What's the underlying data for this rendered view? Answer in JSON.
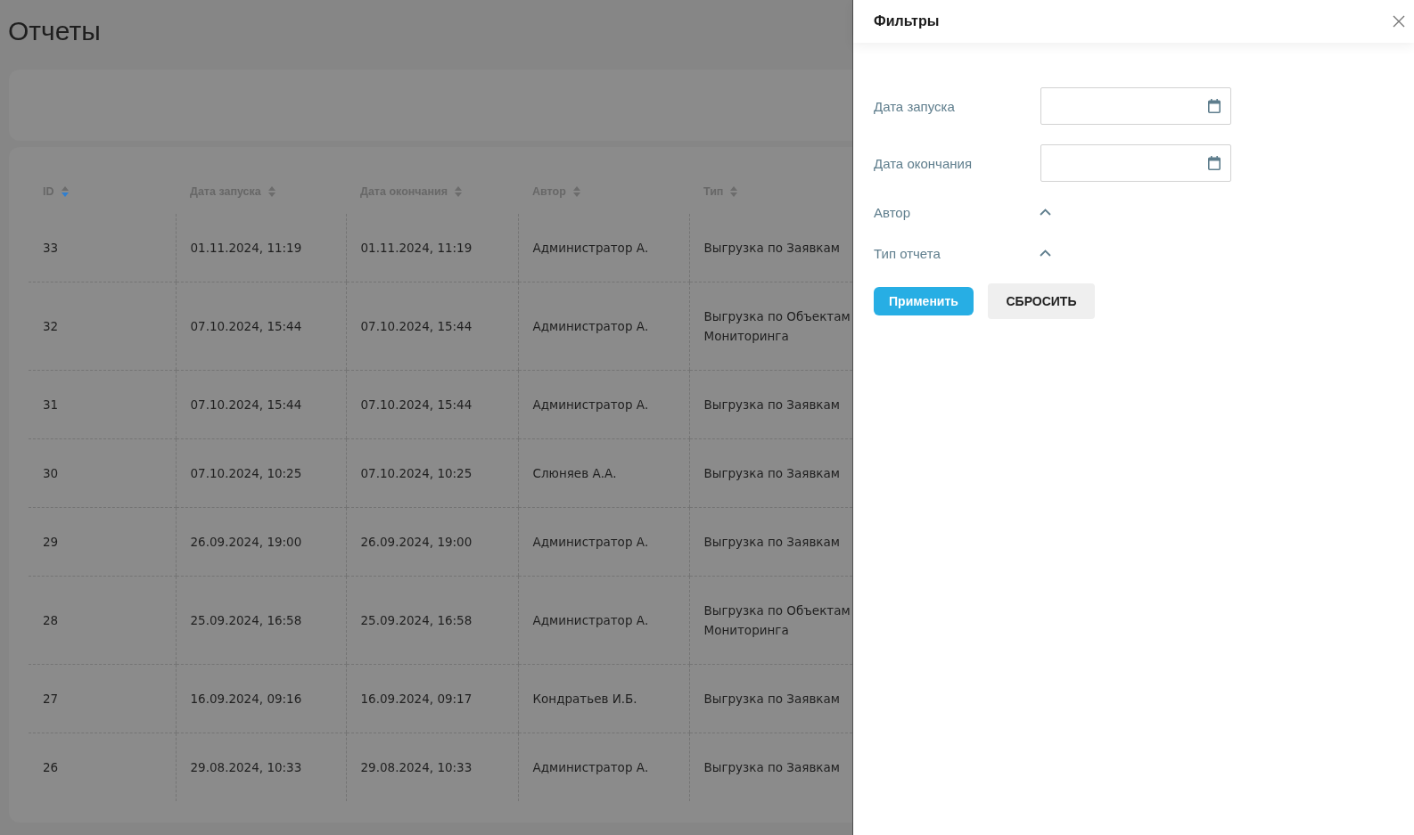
{
  "page": {
    "title": "Отчеты"
  },
  "table": {
    "columns": [
      {
        "label": "ID",
        "sort_descending": true
      },
      {
        "label": "Дата запуска",
        "sort_descending": false
      },
      {
        "label": "Дата окончания",
        "sort_descending": false
      },
      {
        "label": "Автор",
        "sort_descending": false
      },
      {
        "label": "Тип",
        "sort_descending": false
      }
    ],
    "rows": [
      [
        "33",
        "01.11.2024, 11:19",
        "01.11.2024, 11:19",
        "Администратор А.",
        "Выгрузка по Заявкам"
      ],
      [
        "32",
        "07.10.2024, 15:44",
        "07.10.2024, 15:44",
        "Администратор А.",
        "Выгрузка по Объектам Мониторинга"
      ],
      [
        "31",
        "07.10.2024, 15:44",
        "07.10.2024, 15:44",
        "Администратор А.",
        "Выгрузка по Заявкам"
      ],
      [
        "30",
        "07.10.2024, 10:25",
        "07.10.2024, 10:25",
        "Слюняев А.А.",
        "Выгрузка по Заявкам"
      ],
      [
        "29",
        "26.09.2024, 19:00",
        "26.09.2024, 19:00",
        "Администратор А.",
        "Выгрузка по Заявкам"
      ],
      [
        "28",
        "25.09.2024, 16:58",
        "25.09.2024, 16:58",
        "Администратор А.",
        "Выгрузка по Объектам Мониторинга"
      ],
      [
        "27",
        "16.09.2024, 09:16",
        "16.09.2024, 09:17",
        "Кондратьев И.Б.",
        "Выгрузка по Заявкам"
      ],
      [
        "26",
        "29.08.2024, 10:33",
        "29.08.2024, 10:33",
        "Администратор А.",
        "Выгрузка по Заявкам"
      ]
    ]
  },
  "filter_panel": {
    "title": "Фильтры",
    "fields": [
      {
        "kind": "date",
        "label": "Дата запуска"
      },
      {
        "kind": "date",
        "label": "Дата окончания"
      },
      {
        "kind": "dropdown",
        "label": "Автор"
      },
      {
        "kind": "dropdown",
        "label": "Тип отчета"
      }
    ],
    "buttons": [
      {
        "kind": "primary",
        "label": "Применить"
      },
      {
        "kind": "secondary",
        "label": "СБРОСИТЬ"
      }
    ]
  }
}
